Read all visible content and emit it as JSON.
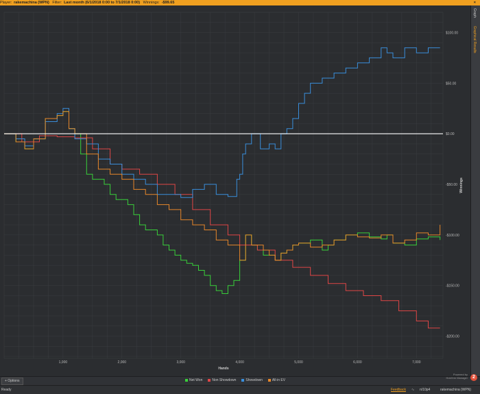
{
  "topbar": {
    "player_label": "Player:",
    "player_value": "rakemachina (WPN)",
    "filter_label": "Filter:",
    "filter_value": "Last month (6/1/2018 0:00 to 7/1/2018 0:00)",
    "winnings_label": "Winnings:",
    "winnings_value": "-$99.65",
    "close_glyph": "×"
  },
  "sidetabs": {
    "tab1": "Graph",
    "tab2": "Graphical Results"
  },
  "bottombar": {
    "options_label": "+ Options",
    "powered_by": "Powered by",
    "brand": "Hold'em Manager",
    "brand_logo_glyph": "2"
  },
  "statusbar": {
    "status": "Ready",
    "feedback": "Feedback",
    "rss_icon": "rss-icon",
    "hands": "n/10p4",
    "player": "rakemachina (WPN)"
  },
  "colors": {
    "netwon": "#39d13a",
    "nonshowdown": "#e04646",
    "showdown": "#3a8fdc",
    "allinev": "#e8872a",
    "zero": "#ffffff",
    "grid": "#3a3d40",
    "accent": "#f0a020"
  },
  "chart_data": {
    "type": "line",
    "xlabel": "Hands",
    "ylabel": "Winnings",
    "xlim": [
      0,
      7450
    ],
    "ylim": [
      -222,
      120
    ],
    "xticks": [
      1000,
      2000,
      3000,
      4000,
      5000,
      6000,
      7000
    ],
    "xtick_labels": [
      "1,000",
      "2,000",
      "3,000",
      "4,000",
      "5,000",
      "6,000",
      "7,000"
    ],
    "yticks": [
      100,
      50,
      0,
      -50,
      -100,
      -150,
      -200
    ],
    "ytick_labels": [
      "$100.00",
      "$50.00",
      "$0.00",
      "-$50.00",
      "-$100.00",
      "-$150.00",
      "-$200.00"
    ],
    "grid": true,
    "legend_position": "bottom",
    "series": [
      {
        "name": "Net Won",
        "key": "netwon",
        "x": [
          0,
          200,
          350,
          500,
          700,
          900,
          1000,
          1100,
          1200,
          1300,
          1400,
          1500,
          1700,
          1800,
          1900,
          2000,
          2100,
          2200,
          2300,
          2400,
          2500,
          2600,
          2700,
          2800,
          2900,
          3000,
          3100,
          3200,
          3300,
          3400,
          3500,
          3600,
          3700,
          3800,
          3900,
          4000,
          4100,
          4200,
          4300,
          4400,
          4500,
          4600,
          4700,
          4800,
          4900,
          5000,
          5200,
          5400,
          5500,
          5600,
          5800,
          6000,
          6200,
          6400,
          6500,
          6600,
          6800,
          7000,
          7200,
          7400
        ],
        "y": [
          0,
          -8,
          -15,
          -5,
          15,
          18,
          22,
          5,
          0,
          -20,
          -40,
          -45,
          -50,
          -60,
          -65,
          -65,
          -70,
          -80,
          -90,
          -95,
          -95,
          -100,
          -110,
          -115,
          -120,
          -125,
          -128,
          -130,
          -135,
          -140,
          -150,
          -155,
          -158,
          -150,
          -145,
          -125,
          -100,
          -110,
          -115,
          -120,
          -120,
          -125,
          -118,
          -115,
          -110,
          -108,
          -105,
          -115,
          -110,
          -105,
          -100,
          -98,
          -102,
          -104,
          -100,
          -108,
          -110,
          -104,
          -102,
          -105
        ]
      },
      {
        "name": "Non Showdown",
        "key": "nonshowdown",
        "x": [
          0,
          300,
          600,
          900,
          1200,
          1500,
          1800,
          2000,
          2300,
          2600,
          2900,
          3200,
          3500,
          3800,
          4000,
          4300,
          4600,
          4900,
          5200,
          5500,
          5800,
          6100,
          6400,
          6700,
          7000,
          7200,
          7400
        ],
        "y": [
          0,
          -8,
          -2,
          -3,
          -4,
          -15,
          -30,
          -35,
          -40,
          -50,
          -60,
          -75,
          -90,
          -100,
          -110,
          -115,
          -125,
          -132,
          -140,
          -148,
          -155,
          -160,
          -165,
          -175,
          -185,
          -192,
          -192
        ]
      },
      {
        "name": "Showdown",
        "key": "showdown",
        "x": [
          0,
          200,
          350,
          500,
          700,
          900,
          1000,
          1100,
          1200,
          1400,
          1600,
          1800,
          2000,
          2200,
          2400,
          2600,
          2800,
          3000,
          3200,
          3400,
          3600,
          3800,
          3950,
          4000,
          4050,
          4100,
          4200,
          4350,
          4500,
          4600,
          4700,
          4800,
          4900,
          5000,
          5100,
          5200,
          5400,
          5600,
          5800,
          6000,
          6200,
          6400,
          6500,
          6600,
          6800,
          7000,
          7200,
          7400
        ],
        "y": [
          0,
          -5,
          -12,
          -5,
          12,
          20,
          25,
          5,
          -5,
          -10,
          -25,
          -30,
          -40,
          -45,
          -50,
          -60,
          -60,
          -63,
          -55,
          -50,
          -60,
          -62,
          -45,
          -40,
          -20,
          -10,
          0,
          -15,
          -10,
          -15,
          0,
          5,
          15,
          30,
          40,
          50,
          55,
          60,
          65,
          70,
          75,
          85,
          80,
          75,
          85,
          80,
          85,
          85
        ]
      },
      {
        "name": "All-in EV",
        "key": "allinev",
        "x": [
          0,
          200,
          350,
          500,
          700,
          900,
          1000,
          1100,
          1200,
          1400,
          1600,
          1800,
          2000,
          2200,
          2400,
          2600,
          2800,
          3000,
          3200,
          3400,
          3600,
          3800,
          4000,
          4100,
          4200,
          4300,
          4400,
          4500,
          4600,
          4700,
          4800,
          4900,
          5000,
          5200,
          5400,
          5600,
          5800,
          6000,
          6200,
          6400,
          6600,
          6800,
          7000,
          7200,
          7400
        ],
        "y": [
          0,
          -8,
          -15,
          -5,
          15,
          18,
          22,
          5,
          0,
          -20,
          -35,
          -40,
          -45,
          -55,
          -60,
          -70,
          -75,
          -85,
          -90,
          -95,
          -105,
          -110,
          -125,
          -100,
          -110,
          -110,
          -115,
          -120,
          -125,
          -118,
          -115,
          -110,
          -108,
          -112,
          -110,
          -105,
          -100,
          -102,
          -103,
          -100,
          -108,
          -105,
          -98,
          -100,
          -90
        ]
      }
    ]
  }
}
